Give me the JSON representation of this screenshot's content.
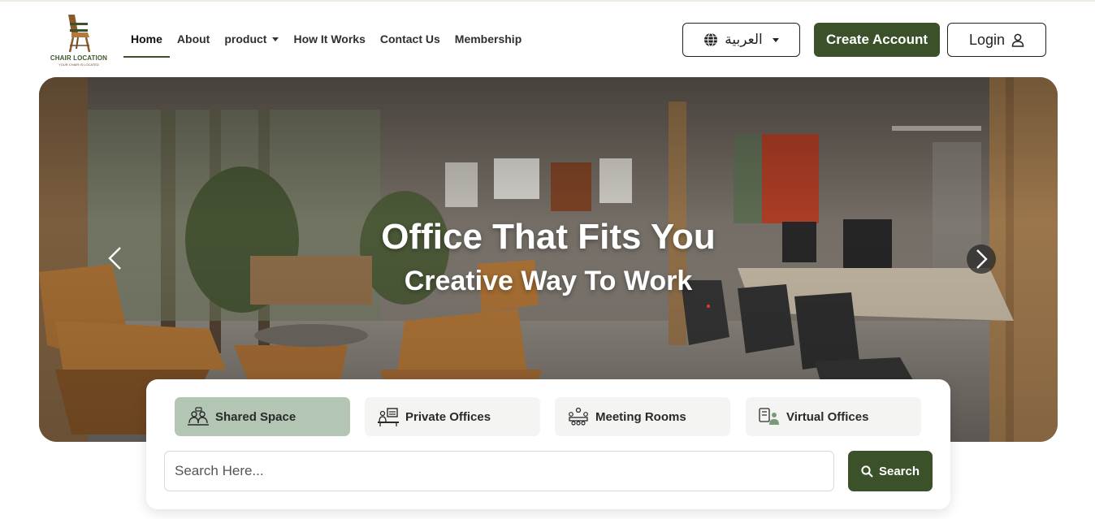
{
  "brand": {
    "name": "CHAIR LOCATION",
    "tagline": "YOUR CHAIR IS LOCATED",
    "accent_color": "#3b5129"
  },
  "nav": {
    "items": [
      {
        "label": "Home",
        "active": true
      },
      {
        "label": "About"
      },
      {
        "label": "product",
        "has_dropdown": true
      },
      {
        "label": "How It Works"
      },
      {
        "label": "Contact Us"
      },
      {
        "label": "Membership"
      }
    ]
  },
  "header": {
    "language_label": "العربية",
    "create_account_label": "Create Account",
    "login_label": "Login"
  },
  "hero": {
    "title": "Office That Fits You",
    "subtitle": "Creative Way To Work"
  },
  "search": {
    "tabs": [
      {
        "label": "Shared Space",
        "icon": "shared-space-icon",
        "active": true
      },
      {
        "label": "Private Offices",
        "icon": "private-offices-icon"
      },
      {
        "label": "Meeting Rooms",
        "icon": "meeting-rooms-icon"
      },
      {
        "label": "Virtual Offices",
        "icon": "virtual-offices-icon"
      }
    ],
    "placeholder": "Search Here...",
    "button_label": "Search"
  }
}
